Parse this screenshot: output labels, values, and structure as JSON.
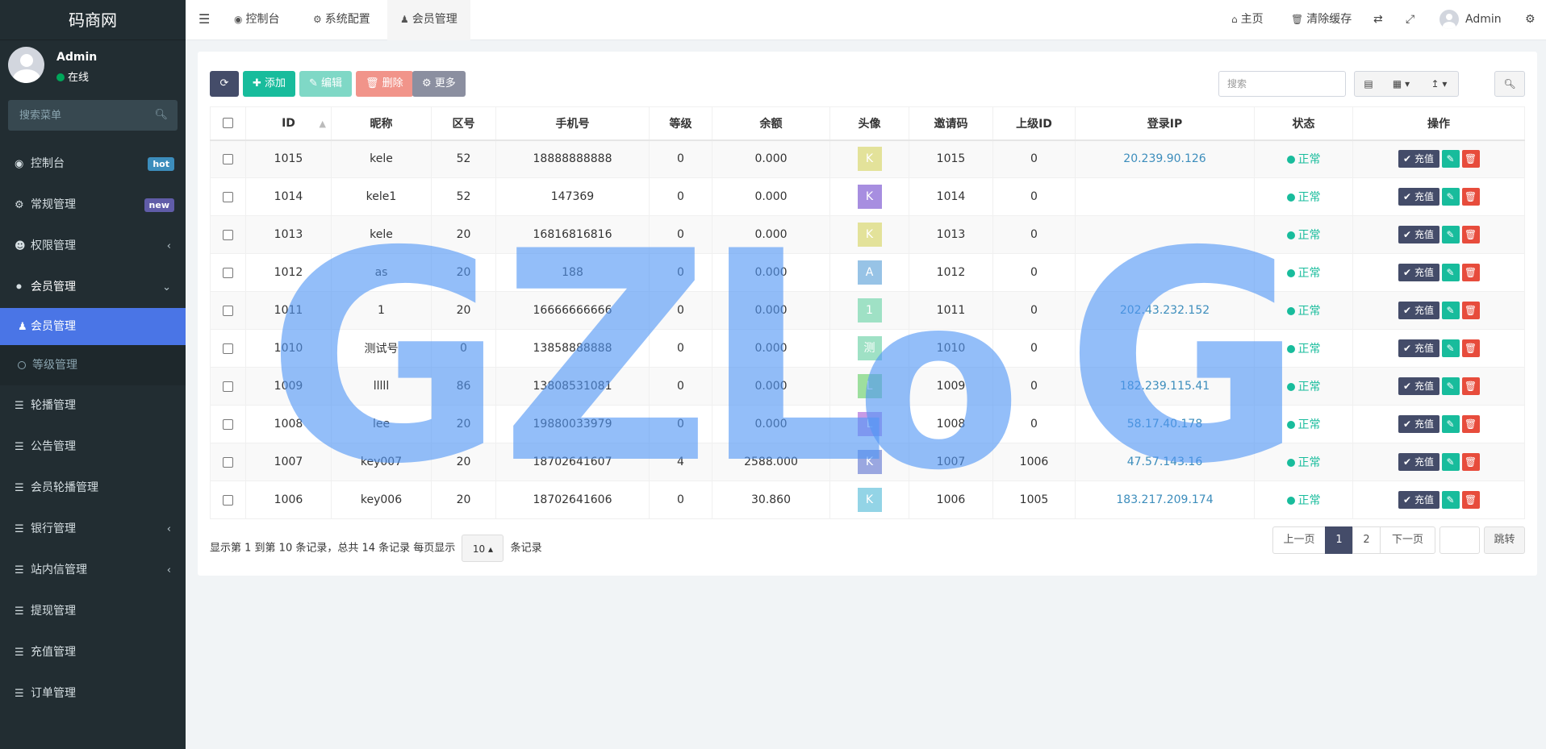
{
  "sidebar": {
    "brand": "码商网",
    "user": {
      "name": "Admin",
      "status": "在线"
    },
    "search_placeholder": "搜索菜单",
    "items": [
      {
        "label": "控制台",
        "icon": "dashboard-icon",
        "badge": "hot",
        "badge_color": "#3c8dbc"
      },
      {
        "label": "常规管理",
        "icon": "cogs-icon",
        "badge": "new",
        "badge_color": "#605ca8"
      },
      {
        "label": "权限管理",
        "icon": "users-icon"
      },
      {
        "label": "会员管理",
        "icon": "user-circle-icon"
      },
      {
        "label": "会员管理",
        "icon": "user-icon"
      },
      {
        "label": "等级管理",
        "icon": "circle-icon"
      },
      {
        "label": "轮播管理",
        "icon": "list-icon"
      },
      {
        "label": "公告管理",
        "icon": "list-icon"
      },
      {
        "label": "会员轮播管理",
        "icon": "list-icon"
      },
      {
        "label": "银行管理",
        "icon": "list-icon"
      },
      {
        "label": "站内信管理",
        "icon": "list-icon"
      },
      {
        "label": "提现管理",
        "icon": "list-icon"
      },
      {
        "label": "充值管理",
        "icon": "list-icon"
      },
      {
        "label": "订单管理",
        "icon": "list-icon"
      }
    ]
  },
  "topbar": {
    "tabs": [
      "控制台",
      "系统配置",
      "会员管理"
    ],
    "home": "主页",
    "clear_cache": "清除缓存",
    "user": "Admin"
  },
  "toolbar": {
    "add": "添加",
    "edit": "编辑",
    "delete": "删除",
    "more": "更多",
    "search_placeholder": "搜索"
  },
  "table": {
    "columns": [
      "ID",
      "昵称",
      "区号",
      "手机号",
      "等级",
      "余额",
      "头像",
      "邀请码",
      "上级ID",
      "登录IP",
      "状态",
      "操作"
    ],
    "rows": [
      {
        "id": "1015",
        "nick": "kele",
        "area": "52",
        "phone": "18888888888",
        "level": "0",
        "balance": "0.000",
        "avatar": "K",
        "avatar_color": "#e3e29a",
        "invite": "1015",
        "parent": "0",
        "ip": "20.239.90.126",
        "status": "正常"
      },
      {
        "id": "1014",
        "nick": "kele1",
        "area": "52",
        "phone": "147369",
        "level": "0",
        "balance": "0.000",
        "avatar": "K",
        "avatar_color": "#a78ee0",
        "invite": "1014",
        "parent": "0",
        "ip": "",
        "status": "正常"
      },
      {
        "id": "1013",
        "nick": "kele",
        "area": "20",
        "phone": "16816816816",
        "level": "0",
        "balance": "0.000",
        "avatar": "K",
        "avatar_color": "#e3e29a",
        "invite": "1013",
        "parent": "0",
        "ip": "",
        "status": "正常"
      },
      {
        "id": "1012",
        "nick": "as",
        "area": "20",
        "phone": "188",
        "level": "0",
        "balance": "0.000",
        "avatar": "A",
        "avatar_color": "#97c3e6",
        "invite": "1012",
        "parent": "0",
        "ip": "",
        "status": "正常"
      },
      {
        "id": "1011",
        "nick": "1",
        "area": "20",
        "phone": "16666666666",
        "level": "0",
        "balance": "0.000",
        "avatar": "1",
        "avatar_color": "#9fe1c5",
        "invite": "1011",
        "parent": "0",
        "ip": "202.43.232.152",
        "status": "正常"
      },
      {
        "id": "1010",
        "nick": "测试号",
        "area": "0",
        "phone": "13858888888",
        "level": "0",
        "balance": "0.000",
        "avatar": "测",
        "avatar_color": "#9fe1c5",
        "invite": "1010",
        "parent": "0",
        "ip": "",
        "status": "正常"
      },
      {
        "id": "1009",
        "nick": "lllll",
        "area": "86",
        "phone": "13808531081",
        "level": "0",
        "balance": "0.000",
        "avatar": "L",
        "avatar_color": "#9ddf9e",
        "invite": "1009",
        "parent": "0",
        "ip": "182.239.115.41",
        "status": "正常"
      },
      {
        "id": "1008",
        "nick": "lee",
        "area": "20",
        "phone": "19880033979",
        "level": "0",
        "balance": "0.000",
        "avatar": "L",
        "avatar_color": "#c79be6",
        "invite": "1008",
        "parent": "0",
        "ip": "58.17.40.178",
        "status": "正常"
      },
      {
        "id": "1007",
        "nick": "key007",
        "area": "20",
        "phone": "18702641607",
        "level": "4",
        "balance": "2588.000",
        "avatar": "K",
        "avatar_color": "#9aa7e0",
        "invite": "1007",
        "parent": "1006",
        "ip": "47.57.143.16",
        "status": "正常"
      },
      {
        "id": "1006",
        "nick": "key006",
        "area": "20",
        "phone": "18702641606",
        "level": "0",
        "balance": "30.860",
        "avatar": "K",
        "avatar_color": "#93d4e6",
        "invite": "1006",
        "parent": "1005",
        "ip": "183.217.209.174",
        "status": "正常"
      }
    ],
    "op_charge": "充值"
  },
  "footer": {
    "summary": "显示第 1 到第 10 条记录，总共 14 条记录 每页显示",
    "page_size": "10",
    "records": "条记录",
    "prev": "上一页",
    "pages": [
      "1",
      "2"
    ],
    "next": "下一页",
    "jump": "跳转"
  },
  "watermark": {
    "text": [
      "G",
      "Z",
      "L",
      "o",
      "G"
    ]
  },
  "colors": {
    "sidebar_bg": "#222d32",
    "active": "#4a75e6",
    "add": "#18bc9c",
    "edit": "#7fd8c6",
    "delete": "#f1948a",
    "more": "#8b8fa0",
    "refresh": "#444c69"
  }
}
